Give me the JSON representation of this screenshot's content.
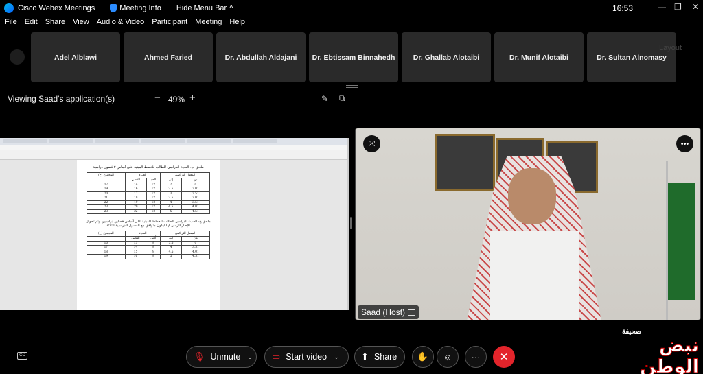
{
  "titlebar": {
    "app_name": "Cisco Webex Meetings",
    "meeting_info": "Meeting Info",
    "hide_menu_bar": "Hide Menu Bar",
    "hide_menu_chevron": "^",
    "time": "16:53",
    "minimize": "—",
    "restore": "❐",
    "close": "✕"
  },
  "menubar": [
    "File",
    "Edit",
    "Share",
    "View",
    "Audio & Video",
    "Participant",
    "Meeting",
    "Help"
  ],
  "participants": [
    "Adel Alblawi",
    "Ahmed Faried",
    "Dr. Abdullah Aldajani",
    "Dr. Ebtissam Binnahedh",
    "Dr. Ghallab Alotaibi",
    "Dr. Munif Alotaibi",
    "Dr. Sultan Alnomasy"
  ],
  "layout_label": "Layout",
  "viewing": {
    "label": "Viewing Saad's application(s)",
    "zoom": "49%",
    "minus": "−",
    "plus": "+"
  },
  "document": {
    "heading1": "ملحق ب: العبء الدراسي للطالب للخطط المبنية على أساس ٣ فصول دراسية",
    "table1_header": [
      "المجموع (ح)",
      "العبء",
      "",
      "المعدل التراكمي",
      ""
    ],
    "table1_subheader": [
      "",
      "الفصي",
      "الحد",
      "إلى",
      "من"
    ],
    "table1_rows": [
      [
        "17",
        "14",
        "12",
        "2",
        "0"
      ],
      [
        "19",
        "16",
        "12",
        "2.5",
        "2.01"
      ],
      [
        "20",
        "17",
        "12",
        "3",
        "2.51"
      ],
      [
        "21",
        "18",
        "12",
        "3.5",
        "3.01"
      ],
      [
        "22",
        "19",
        "12",
        "4",
        "3.51"
      ],
      [
        "23",
        "20",
        "12",
        "4.5",
        "4.01"
      ],
      [
        "23",
        "22",
        "12",
        "5",
        "4.51"
      ]
    ],
    "heading2": "ملحق ج: العبء الدراسي للطالب للخطط المبنية على أساس فصلين دراسيين وتم تحويل الإطار الزمني لها ليكون متوافق مع الفصول الدراسية الثلاثة",
    "table2_header": [
      "المجموع (ح)",
      "العبء",
      "",
      "المعدل التراكمي",
      ""
    ],
    "table2_subheader": [
      "",
      "الفصي",
      "أدنى",
      "إلى",
      "من"
    ],
    "table2_rows": [
      [
        "16",
        "13",
        "9",
        "3.5",
        "0"
      ],
      [
        "17",
        "14",
        "9",
        "4",
        "3.51"
      ],
      [
        "18",
        "15",
        "9",
        "4.5",
        "4.01"
      ],
      [
        "19",
        "16",
        "9",
        "5",
        "4.51"
      ]
    ]
  },
  "video": {
    "name_label": "Saad (Host)",
    "pin_icon_glyph": "⤧",
    "more_glyph": "•••"
  },
  "controls": {
    "unmute": "Unmute",
    "start_video": "Start video",
    "share": "Share",
    "chevron": "⌄",
    "mic_glyph": "🎙",
    "cam_glyph": "▭",
    "share_glyph": "⬆",
    "raise_glyph": "✋",
    "react_glyph": "☺",
    "more_glyph": "···",
    "leave_glyph": "✕",
    "cc_glyph": "CC"
  },
  "watermark": {
    "text": "نبض الوطن",
    "subtext": "صحيفة"
  },
  "colors": {
    "leave": "#e3242b",
    "accent": "#00bceb"
  }
}
